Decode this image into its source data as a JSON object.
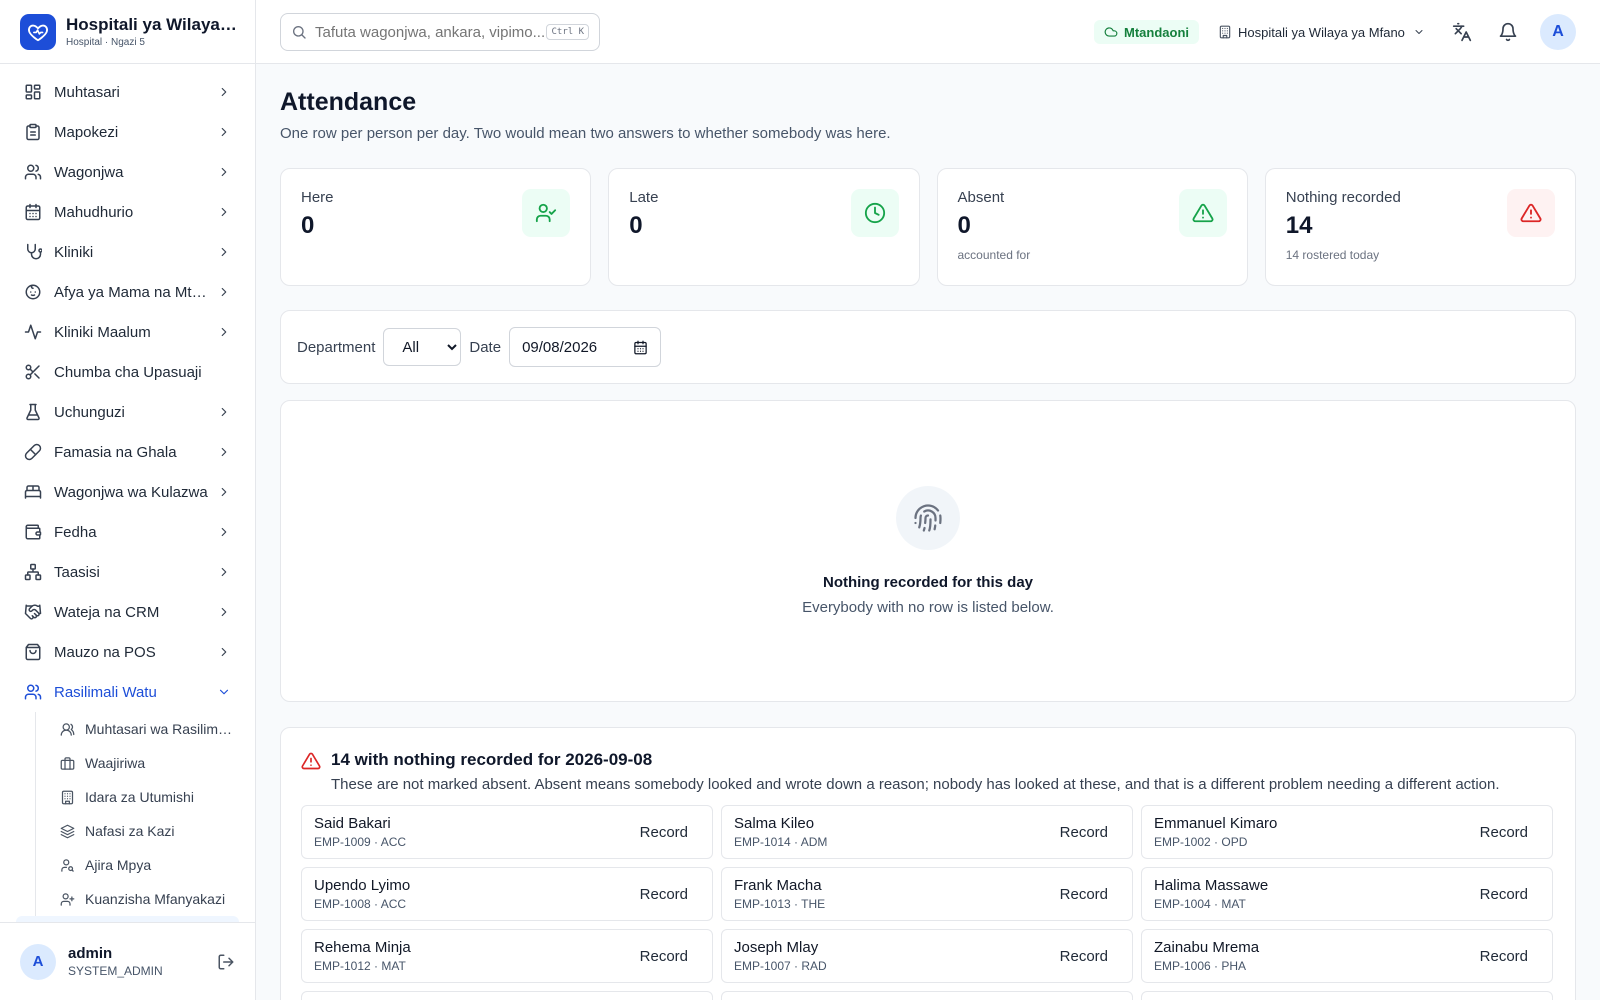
{
  "brand": {
    "title": "Hospitali ya Wilaya ya Mfano",
    "subtitle": "Hospital · Ngazi 5"
  },
  "sidebar": {
    "items": [
      {
        "label": "Muhtasari",
        "icon": "dashboard-icon",
        "chevron": true
      },
      {
        "label": "Mapokezi",
        "icon": "clipboard-icon",
        "chevron": true
      },
      {
        "label": "Wagonjwa",
        "icon": "users-icon",
        "chevron": true
      },
      {
        "label": "Mahudhurio",
        "icon": "calendar-icon",
        "chevron": true
      },
      {
        "label": "Kliniki",
        "icon": "stethoscope-icon",
        "chevron": true
      },
      {
        "label": "Afya ya Mama na Mtoto",
        "icon": "baby-icon",
        "chevron": true
      },
      {
        "label": "Kliniki Maalum",
        "icon": "activity-icon",
        "chevron": true
      },
      {
        "label": "Chumba cha Upasuaji",
        "icon": "scissors-icon",
        "chevron": false
      },
      {
        "label": "Uchunguzi",
        "icon": "flask-icon",
        "chevron": true
      },
      {
        "label": "Famasia na Ghala",
        "icon": "pill-icon",
        "chevron": true
      },
      {
        "label": "Wagonjwa wa Kulazwa",
        "icon": "bed-icon",
        "chevron": true
      },
      {
        "label": "Fedha",
        "icon": "wallet-icon",
        "chevron": true
      },
      {
        "label": "Taasisi",
        "icon": "network-icon",
        "chevron": true
      },
      {
        "label": "Wateja na CRM",
        "icon": "handshake-icon",
        "chevron": true
      },
      {
        "label": "Mauzo na POS",
        "icon": "shopping-bag-icon",
        "chevron": true
      },
      {
        "label": "Rasilimali Watu",
        "icon": "users-icon",
        "chevron": true,
        "active": true
      }
    ],
    "sub_items": [
      {
        "label": "Muhtasari wa Rasilimali Watu",
        "icon": "user-group-icon"
      },
      {
        "label": "Waajiriwa",
        "icon": "briefcase-icon"
      },
      {
        "label": "Idara za Utumishi",
        "icon": "building-icon"
      },
      {
        "label": "Nafasi za Kazi",
        "icon": "layers-icon"
      },
      {
        "label": "Ajira Mpya",
        "icon": "user-search-icon"
      },
      {
        "label": "Kuanzisha Mfanyakazi",
        "icon": "user-plus-icon"
      }
    ]
  },
  "user": {
    "initial": "A",
    "name": "admin",
    "role": "SYSTEM_ADMIN"
  },
  "header": {
    "search_placeholder": "Tafuta wagonjwa, ankara, vipimo...",
    "shortcut": "Ctrl K",
    "online_label": "Mtandaoni",
    "facility": "Hospitali ya Wilaya ya Mfano",
    "avatar_initial": "A"
  },
  "page": {
    "title": "Attendance",
    "subtitle": "One row per person per day. Two would mean two answers to whether somebody was here."
  },
  "stats": [
    {
      "label": "Here",
      "value": "0",
      "note": "",
      "icon": "user-check-icon",
      "tone": "green"
    },
    {
      "label": "Late",
      "value": "0",
      "note": "",
      "icon": "clock-icon",
      "tone": "green"
    },
    {
      "label": "Absent",
      "value": "0",
      "note": "accounted for",
      "icon": "alert-triangle-icon",
      "tone": "green"
    },
    {
      "label": "Nothing recorded",
      "value": "14",
      "note": "14 rostered today",
      "icon": "alert-triangle-icon",
      "tone": "red"
    }
  ],
  "filters": {
    "department_label": "Department",
    "department_value": "All",
    "date_label": "Date",
    "date_value": "09/08/2026"
  },
  "empty": {
    "title": "Nothing recorded for this day",
    "subtitle": "Everybody with no row is listed below."
  },
  "missing": {
    "title": "14 with nothing recorded for 2026-09-08",
    "subtitle": "These are not marked absent. Absent means somebody looked and wrote down a reason; nobody has looked at these, and that is a different problem needing a different action.",
    "record_label": "Record",
    "people": [
      {
        "name": "Said Bakari",
        "meta": "EMP-1009 · ACC"
      },
      {
        "name": "Salma Kileo",
        "meta": "EMP-1014 · ADM"
      },
      {
        "name": "Emmanuel Kimaro",
        "meta": "EMP-1002 · OPD"
      },
      {
        "name": "Upendo Lyimo",
        "meta": "EMP-1008 · ACC"
      },
      {
        "name": "Frank Macha",
        "meta": "EMP-1013 · THE"
      },
      {
        "name": "Halima Massawe",
        "meta": "EMP-1004 · MAT"
      },
      {
        "name": "Rehema Minja",
        "meta": "EMP-1012 · MAT"
      },
      {
        "name": "Joseph Mlay",
        "meta": "EMP-1007 · RAD"
      },
      {
        "name": "Zainabu Mrema",
        "meta": "EMP-1006 · PHA"
      }
    ]
  }
}
